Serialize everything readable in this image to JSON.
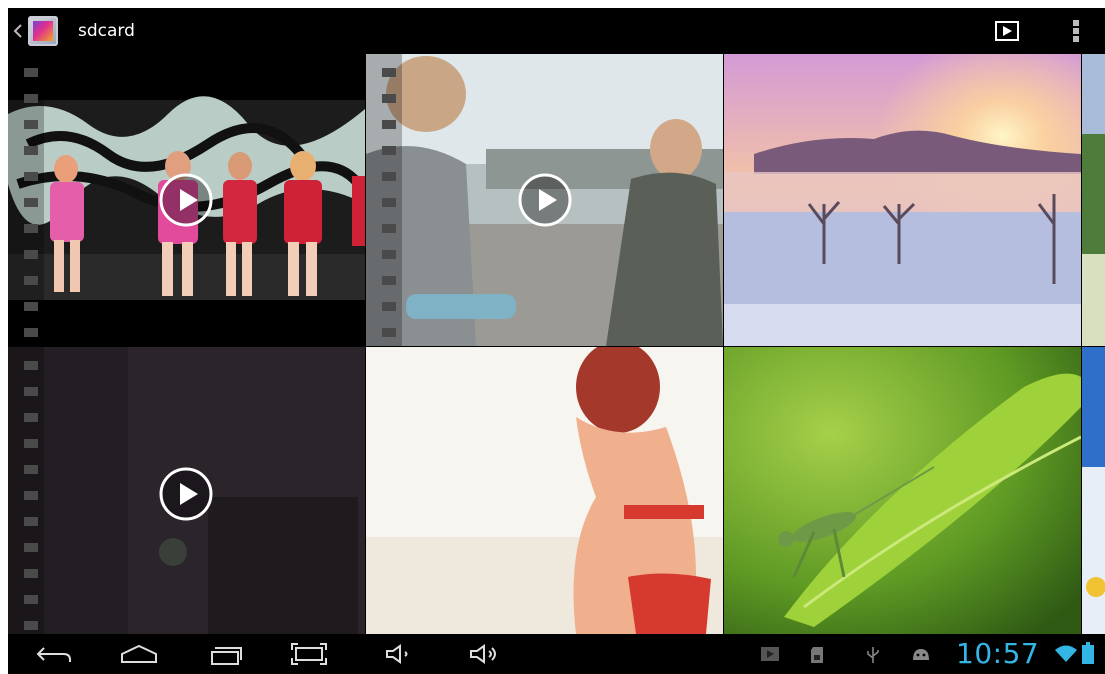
{
  "action_bar": {
    "title": "sdcard",
    "up_icon": "chevron-left-icon",
    "app_icon": "gallery-icon",
    "slideshow_icon": "slideshow-play-icon",
    "overflow_icon": "overflow-menu-icon"
  },
  "grid": {
    "tiles": [
      {
        "kind": "video",
        "subject": "stage-performance"
      },
      {
        "kind": "video",
        "subject": "people-outdoors"
      },
      {
        "kind": "photo",
        "subject": "sunrise-landscape"
      },
      {
        "kind": "photo",
        "subject": "partial-edge"
      },
      {
        "kind": "video",
        "subject": "dark-door"
      },
      {
        "kind": "photo",
        "subject": "beach-person"
      },
      {
        "kind": "photo",
        "subject": "grasshopper-leaf"
      },
      {
        "kind": "photo",
        "subject": "partial-edge"
      }
    ],
    "play_icon": "play-circle-icon"
  },
  "nav_bar": {
    "back_icon": "back-icon",
    "home_icon": "home-icon",
    "recents_icon": "recent-apps-icon",
    "screenshot_icon": "screenshot-icon",
    "volume_down_icon": "volume-down-icon",
    "volume_up_icon": "volume-up-icon"
  },
  "status_bar": {
    "time": "10:57",
    "accent_color": "#33b5e5",
    "icons": [
      "media-play-icon",
      "sd-card-icon",
      "usb-icon",
      "android-debug-icon",
      "wifi-icon",
      "battery-icon"
    ]
  }
}
